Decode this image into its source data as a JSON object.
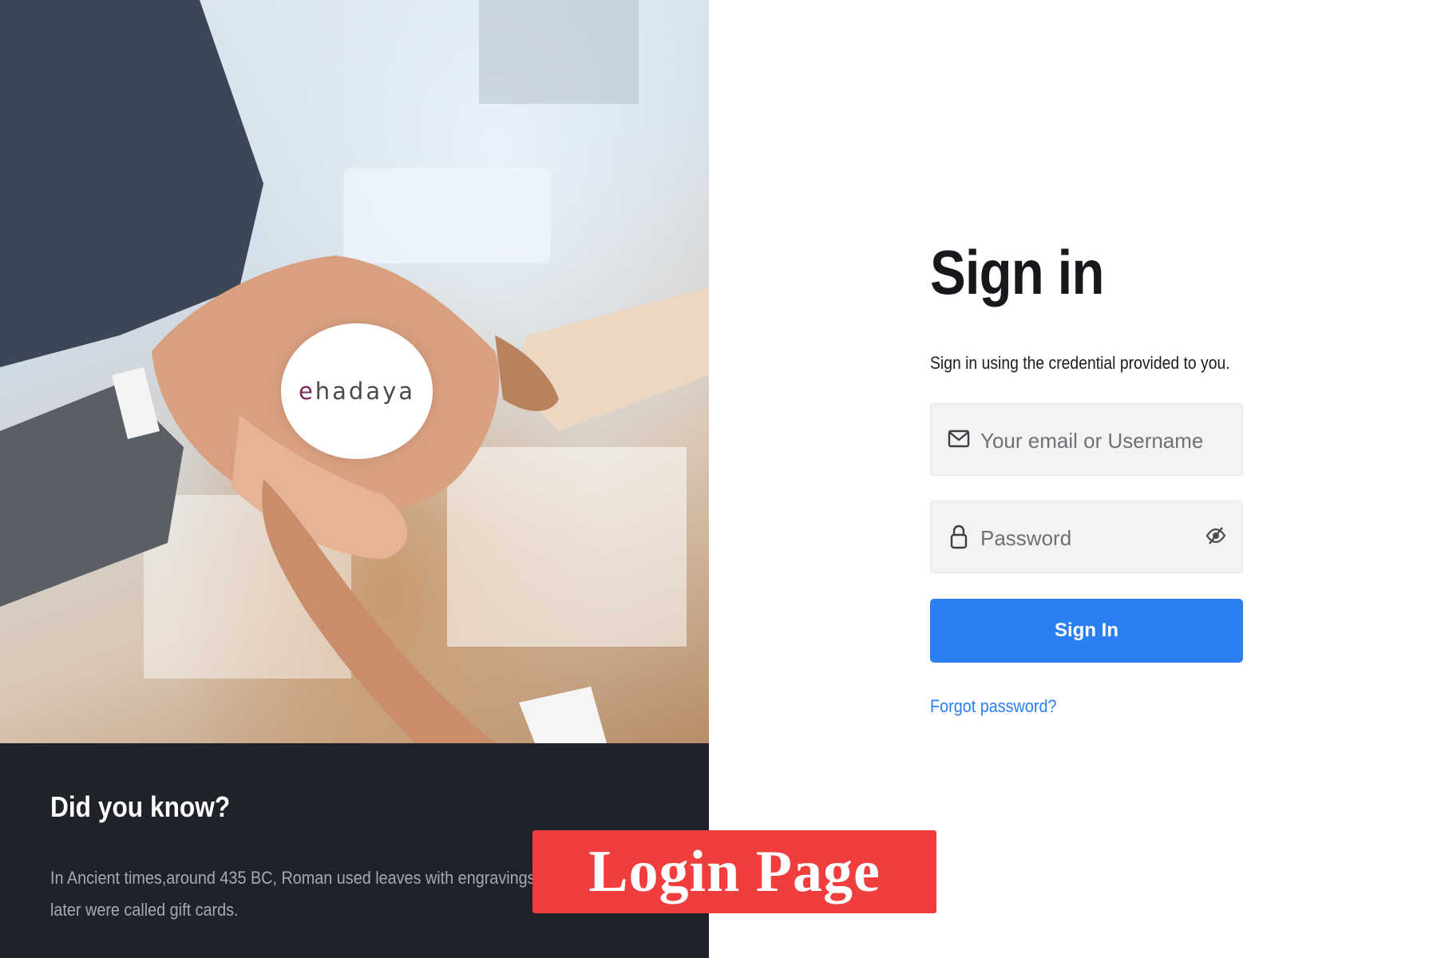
{
  "brand": {
    "logo_prefix": "e",
    "logo_rest": "hadaya",
    "accent_color": "#7a2a5a"
  },
  "info": {
    "title": "Did you know?",
    "text": "In Ancient times,around 435 BC, Roman used leaves with engravings ... later were called gift cards."
  },
  "signin": {
    "title": "Sign in",
    "subtitle": "Sign in using the credential provided to you.",
    "email_placeholder": "Your email or Username",
    "password_placeholder": "Password",
    "button_label": "Sign In",
    "forgot_label": "Forgot password?",
    "email_icon": "envelope-icon",
    "password_icon": "lock-icon",
    "toggle_icon": "eye-off-icon",
    "primary_color": "#2a7ff3"
  },
  "badge": {
    "label": "Login Page",
    "color": "#f03e3e"
  }
}
